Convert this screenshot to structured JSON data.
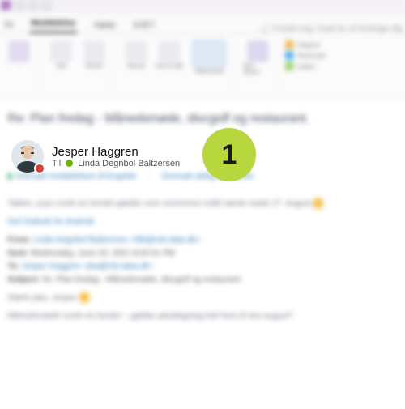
{
  "window": {
    "tabs": [
      "Fil",
      "Meddelelse",
      "Hjælp",
      "ESET"
    ],
    "active_tab": "Meddelelse",
    "tell_me": "Fortæl mig, hvad du vil foretage dig"
  },
  "ribbon": {
    "buttons": {
      "delete": "Slet",
      "archive": "Arkivér",
      "reply": "Besvar",
      "reply_all": "Svar til alle",
      "forward": "Videresend",
      "teams": "Del i Teams"
    },
    "quicksteps": [
      "Opgave",
      "Teammail",
      "Udført"
    ]
  },
  "message": {
    "subject": "Re: Plan fredag - Månedsmøde, discgolf og restaurant.",
    "sender_name": "Jesper Haggren",
    "sender_presence": "busy",
    "to_label": "Til",
    "recipients": [
      {
        "name": "Linda Degnbol Baltzersen",
        "presence": "available"
      }
    ],
    "translate_bar": {
      "left": "Oversæt meddelelsen til Engelsk",
      "right": "Oversæt aldrig fra Dansk"
    },
    "body_line": "Takker, yoyo rundt om bordet gælder over sommeren indtil næste møde 27. August",
    "signature_line": "Get Outlook for Android",
    "quoted_headers": {
      "from_label": "From:",
      "from_value": "Linda Degnbol Baltzersen <ldb@mb-data.dk>",
      "sent_label": "Sent:",
      "sent_value": "Wednesday, June 23, 2021 8:04:51 PM",
      "to_label": "To:",
      "to_value": "Jesper Haggren <jha@mb-data.dk>",
      "subject_label": "Subject:",
      "subject_value": "Sv: Plan fredag - Månedsmøde, discgolf og restaurant."
    },
    "quoted_body_1": "Stærk plan, Jesper",
    "quoted_body_2": "Månedsmødet rundt om bordet – gælder planlægning helt frem til slut august?"
  },
  "annotation": {
    "badge_number": "1",
    "badge_color": "#b8d73e"
  }
}
